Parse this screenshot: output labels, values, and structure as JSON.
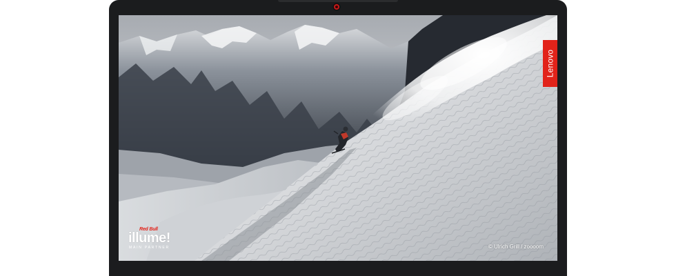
{
  "screen": {
    "brand_label": "Lenovo",
    "partner_top": "Red Bull",
    "partner_name": "illume!",
    "partner_subtitle": "MAIN PARTNER",
    "photo_credit": "© Ulrich Grill / zoooom"
  },
  "colors": {
    "frame": "#1b1c1e",
    "brand_red": "#e2231a",
    "snow": "#e6e8ea",
    "sky": "#c9ccd0",
    "rock": "#262a31"
  }
}
